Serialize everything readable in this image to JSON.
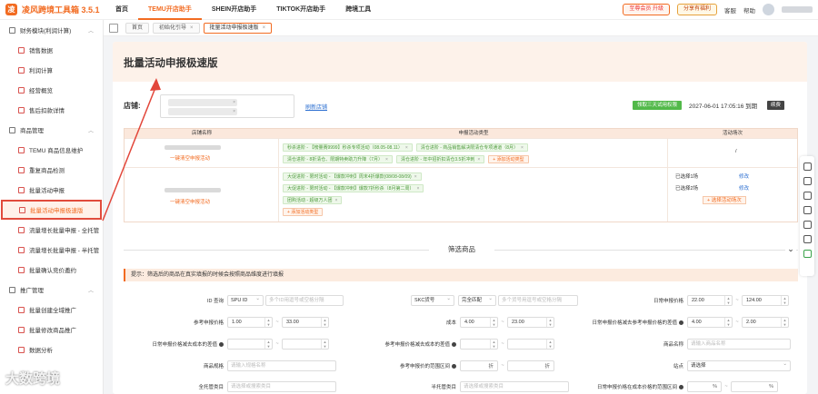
{
  "app": {
    "name": "凌风跨境工具箱 3.5.1",
    "logo_char": "凌"
  },
  "topnav": [
    {
      "label": "首页",
      "active": false
    },
    {
      "label": "TEMU开店助手",
      "active": true
    },
    {
      "label": "SHEIN开店助手",
      "active": false
    },
    {
      "label": "TIKTOK开店助手",
      "active": false
    },
    {
      "label": "跨境工具",
      "active": false
    }
  ],
  "top_right": {
    "member": "至尊会员 升级",
    "invite": "分享有福利",
    "service": "客服",
    "help": "帮助"
  },
  "sidebar": {
    "groups": [
      {
        "label": "财务模块(利润计算)",
        "items": [
          "销售数据",
          "利润计算",
          "经营概览",
          "售后扣款详情"
        ]
      },
      {
        "label": "商品管理",
        "items": [
          "TEMU 商品信息维护",
          "重复商品检测",
          "批量活动申报",
          "批量活动申报极速版",
          "流量增长批量申报 - 全托管",
          "流量增长批量申报 - 半托管",
          "批量确认竞价邀约"
        ]
      },
      {
        "label": "推广管理",
        "items": [
          "批量创建全域推广",
          "批量修改商品推广"
        ]
      }
    ],
    "active_item": "批量活动申报极速版",
    "partial_item": "数据分析"
  },
  "tabs": [
    {
      "label": "首页",
      "closable": false,
      "active": false
    },
    {
      "label": "初始化引导",
      "closable": true,
      "active": false
    },
    {
      "label": "批量活动申报极速版",
      "closable": true,
      "active": true
    }
  ],
  "page": {
    "title": "批量活动申报极速版",
    "store_label": "店铺:",
    "store_link": "刷新店铺",
    "trial_btn": "领取三天试用权限",
    "expire": "2027-06-01 17:05:16 到期",
    "renew_btn": "续费"
  },
  "table": {
    "headers": [
      "店铺名称",
      "申报活动类型",
      "活动场次"
    ],
    "rows": [
      {
        "link": "一键清空申报活动",
        "chips": [
          [
            "秒杀进阶 - 【榜量赛9999】秒杀专项活动（08.05-08.11）",
            "清仓进阶 - 商品销售解决限清仓专项通道（8月）"
          ],
          [
            "清仓进阶 - 8折清仓、限期特卖助力升降（7月）",
            "清仓进阶 - 年中招折扣清仓3.5折冲刺"
          ]
        ],
        "add": "+ 添加活动类型",
        "slots": [
          {
            "left": "/",
            "right": ""
          }
        ]
      },
      {
        "link": "一键清空申报活动",
        "chips": [
          [
            "大促进阶 - 限时活动 - 【爆款冲刺】周末4折爆款(08/08-08/09)"
          ],
          [
            "大促进阶 - 限时活动 - 【爆款冲刺】爆款7折秒杀（8月第二周）"
          ],
          [
            "团购活动 - 超级万人团"
          ]
        ],
        "add": "+ 添加活动类型",
        "slots": [
          {
            "left": "已选择1场",
            "right": "修改"
          },
          {
            "left": "已选择2场",
            "right": "修改"
          },
          {
            "left": "",
            "right": "+ 选择活动场次"
          }
        ]
      }
    ]
  },
  "filter": {
    "title": "筛选商品",
    "hint": "提示：筛选后的商品在真实填报的时候会按照商品维度进行填报"
  },
  "form": {
    "id_query_label": "ID 查询",
    "id_query_type": "SPU ID",
    "id_query_placeholder": "多个ID用逗号或空格分隔",
    "skc_type": "SKC货号",
    "skc_match": "完全匹配",
    "skc_placeholder": "多个货号用逗号或空格分隔",
    "daily_price_label": "日常申报价格",
    "daily_min": "22.00",
    "daily_max": "124.00",
    "ref_price_label": "参考申报价格",
    "ref_min": "1.00",
    "ref_max": "33.00",
    "cost_label": "成本",
    "cost_min": "4.00",
    "cost_max": "23.00",
    "diff_label": "日常申报价格减去参考申报价格的差值",
    "diff_min": "4.00",
    "diff_max": "2.00",
    "row3_label1": "日常申报价格减去成本的差值",
    "row3_label2": "参考申报价格减去成本的差值",
    "goods_name_label": "商品名称",
    "goods_name_placeholder": "请输入商品名称",
    "spec_label": "商品规格",
    "spec_placeholder": "请输入规格名称",
    "discount_label": "参考申报价的范围区间",
    "discount_unit": "折",
    "site_label": "站点",
    "site_value": "请选择",
    "full_cat_label": "全托管类目",
    "full_cat_placeholder": "请选择或搜索类目",
    "half_cat_label": "半托管类目",
    "half_cat_placeholder": "请选择或搜索类目",
    "ratio_label": "日常申报价格在成本价格的范围区间",
    "pct_unit": "%"
  },
  "watermark": "大数跨境"
}
